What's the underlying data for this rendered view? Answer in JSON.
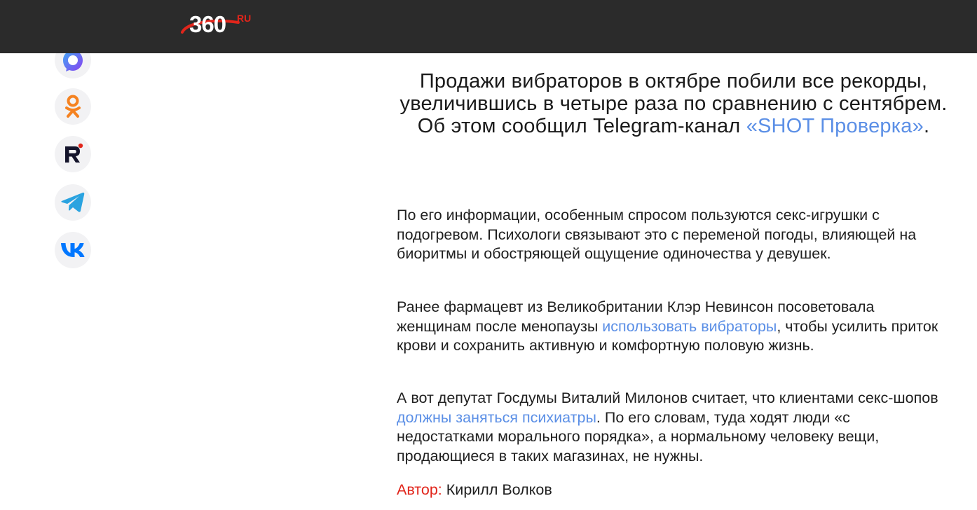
{
  "header": {
    "logo_number": "360",
    "logo_suffix": "RU"
  },
  "social": [
    {
      "name": "max-icon",
      "color": "#6b4df0"
    },
    {
      "name": "odnoklassniki-icon",
      "color": "#f58220"
    },
    {
      "name": "rutube-icon",
      "color": "#14142b"
    },
    {
      "name": "telegram-icon",
      "color": "#2aa3e0"
    },
    {
      "name": "vk-icon",
      "color": "#0077ff"
    }
  ],
  "article": {
    "lead_text": "Продажи вибраторов в октябре побили все рекорды, увеличившись в четыре раза по сравнению с сентябрем. Об этом сообщил Telegram-канал",
    "lead_link": "«SHOT Проверка»",
    "lead_end": ".",
    "p1": "По его информации, особенным спросом пользуются секс-игрушки с подогревом. Психологи связывают это с переменой погоды, влияющей на биоритмы и обостряющей ощущение одиночества у девушек.",
    "p2_before": "Ранее фармацевт из Великобритании Клэр Невинсон посоветовала женщинам после менопаузы",
    "p2_link": "использовать вибраторы",
    "p2_after": ", чтобы усилить приток крови и сохранить активную и комфортную половую жизнь.",
    "p3_before": "А вот депутат Госдумы Виталий Милонов считает, что клиентами секс-шопов",
    "p3_link": "должны заняться психиатры",
    "p3_after": ". По его словам, туда ходят люди «с недостатками морального порядка», а нормальному человеку вещи, продающиеся в таких магазинах, не нужны.",
    "author_label": "Автор:",
    "author_name": "Кирилл Волков"
  },
  "colors": {
    "header_bg": "#2b2b2b",
    "link": "#5b8fe6",
    "accent_red": "#e1251b"
  }
}
